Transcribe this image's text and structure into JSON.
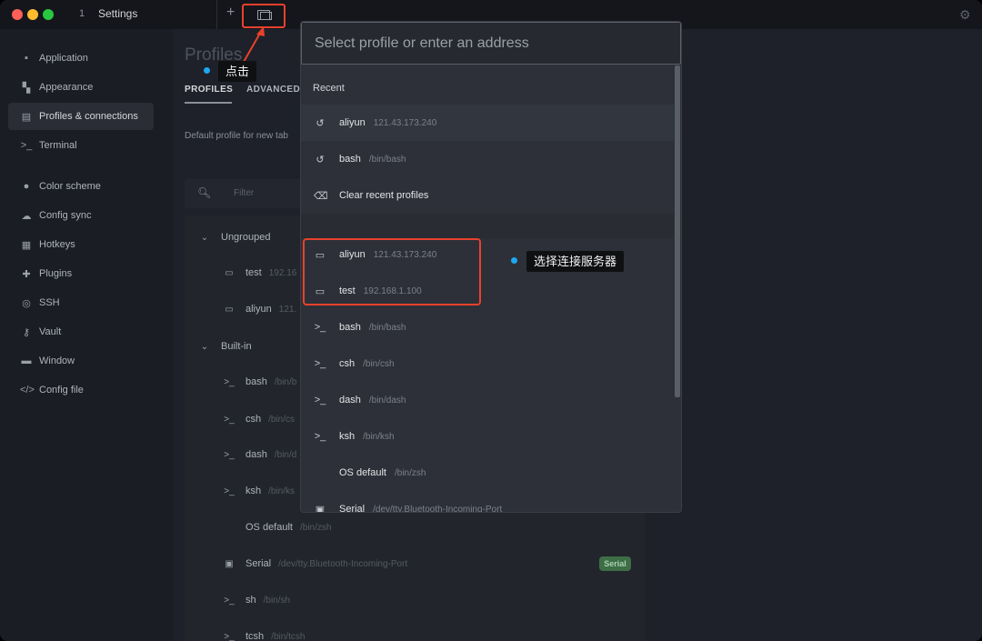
{
  "window": {
    "tab_number": "1",
    "tab_title": "Settings"
  },
  "colors": {
    "accent_red": "#e8412c",
    "callout_dot": "#1ea7f0",
    "badge_green": "#3d6e46"
  },
  "sidebar": {
    "items": [
      {
        "label": "Application",
        "icon": "application-icon"
      },
      {
        "label": "Appearance",
        "icon": "appearance-icon"
      },
      {
        "label": "Profiles & connections",
        "icon": "profiles-icon"
      },
      {
        "label": "Terminal",
        "icon": "terminal-icon"
      },
      {
        "label": "Color scheme",
        "icon": "color-scheme-icon"
      },
      {
        "label": "Config sync",
        "icon": "cloud-icon"
      },
      {
        "label": "Hotkeys",
        "icon": "keyboard-icon"
      },
      {
        "label": "Plugins",
        "icon": "puzzle-icon"
      },
      {
        "label": "SSH",
        "icon": "globe-icon"
      },
      {
        "label": "Vault",
        "icon": "key-icon"
      },
      {
        "label": "Window",
        "icon": "window-icon"
      },
      {
        "label": "Config file",
        "icon": "code-icon"
      }
    ]
  },
  "main": {
    "title": "Profiles",
    "tabs": [
      "PROFILES",
      "ADVANCED"
    ],
    "default_profile_label": "Default profile for new tab",
    "filter_placeholder": "Filter",
    "groups": [
      {
        "name": "Ungrouped",
        "profiles": [
          {
            "name": "test",
            "detail": "192.16",
            "icon": "monitor-icon"
          },
          {
            "name": "aliyun",
            "detail": "121.",
            "icon": "monitor-icon"
          }
        ]
      },
      {
        "name": "Built-in",
        "profiles": [
          {
            "name": "bash",
            "detail": "/bin/b",
            "icon": "prompt-icon"
          },
          {
            "name": "csh",
            "detail": "/bin/cs",
            "icon": "prompt-icon"
          },
          {
            "name": "dash",
            "detail": "/bin/d",
            "icon": "prompt-icon"
          },
          {
            "name": "ksh",
            "detail": "/bin/ks",
            "icon": "prompt-icon"
          },
          {
            "name": "OS default",
            "detail": "/bin/zsh",
            "icon": ""
          },
          {
            "name": "Serial",
            "detail": "/dev/tty.Bluetooth-Incoming-Port",
            "icon": "chip-icon"
          },
          {
            "name": "sh",
            "detail": "/bin/sh",
            "icon": "prompt-icon"
          },
          {
            "name": "tcsh",
            "detail": "/bin/tcsh",
            "icon": "prompt-icon"
          }
        ]
      }
    ],
    "serial_badge": "Serial"
  },
  "dropdown": {
    "placeholder": "Select profile or enter an address",
    "recent_label": "Recent",
    "recent": [
      {
        "name": "aliyun",
        "detail": "121.43.173.240",
        "icon": "history-icon"
      },
      {
        "name": "bash",
        "detail": "/bin/bash",
        "icon": "history-icon"
      }
    ],
    "clear_label": "Clear recent profiles",
    "profiles": [
      {
        "name": "aliyun",
        "detail": "121.43.173.240",
        "icon": "monitor-icon"
      },
      {
        "name": "test",
        "detail": "192.168.1.100",
        "icon": "monitor-icon"
      },
      {
        "name": "bash",
        "detail": "/bin/bash",
        "icon": "prompt-icon"
      },
      {
        "name": "csh",
        "detail": "/bin/csh",
        "icon": "prompt-icon"
      },
      {
        "name": "dash",
        "detail": "/bin/dash",
        "icon": "prompt-icon"
      },
      {
        "name": "ksh",
        "detail": "/bin/ksh",
        "icon": "prompt-icon"
      },
      {
        "name": "OS default",
        "detail": "/bin/zsh",
        "icon": ""
      },
      {
        "name": "Serial",
        "detail": "/dev/tty.Bluetooth-Incoming-Port",
        "icon": "chip-icon"
      }
    ]
  },
  "annotations": {
    "click_label": "点击",
    "select_label": "选择连接服务器"
  }
}
